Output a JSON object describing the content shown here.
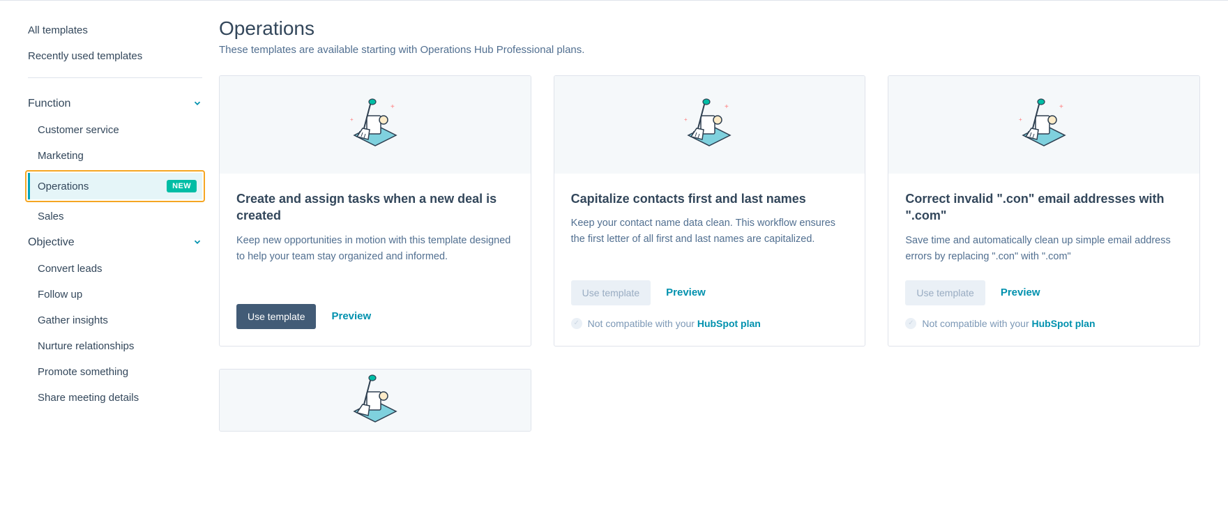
{
  "sidebar": {
    "all_templates": "All templates",
    "recently_used": "Recently used templates",
    "function": {
      "label": "Function",
      "items": [
        {
          "label": "Customer service",
          "active": false
        },
        {
          "label": "Marketing",
          "active": false
        },
        {
          "label": "Operations",
          "active": true,
          "badge": "NEW"
        },
        {
          "label": "Sales",
          "active": false
        }
      ]
    },
    "objective": {
      "label": "Objective",
      "items": [
        {
          "label": "Convert leads"
        },
        {
          "label": "Follow up"
        },
        {
          "label": "Gather insights"
        },
        {
          "label": "Nurture relationships"
        },
        {
          "label": "Promote something"
        },
        {
          "label": "Share meeting details"
        }
      ]
    }
  },
  "page": {
    "title": "Operations",
    "subtitle": "These templates are available starting with Operations Hub Professional plans."
  },
  "buttons": {
    "use_template": "Use template",
    "preview": "Preview"
  },
  "compat": {
    "prefix": "Not compatible with your ",
    "plan_link": "HubSpot plan"
  },
  "cards": [
    {
      "title": "Create and assign tasks when a new deal is created",
      "desc": "Keep new opportunities in motion with this template designed to help your team stay organized and informed.",
      "enabled": true,
      "show_compat": false
    },
    {
      "title": "Capitalize contacts first and last names",
      "desc": "Keep your contact name data clean. This workflow ensures the first letter of all first and last names are capitalized.",
      "enabled": false,
      "show_compat": true
    },
    {
      "title": "Correct invalid \".con\" email addresses with \".com\"",
      "desc": "Save time and automatically clean up simple email address errors by replacing \".con\" with \".com\"",
      "enabled": false,
      "show_compat": true
    }
  ]
}
